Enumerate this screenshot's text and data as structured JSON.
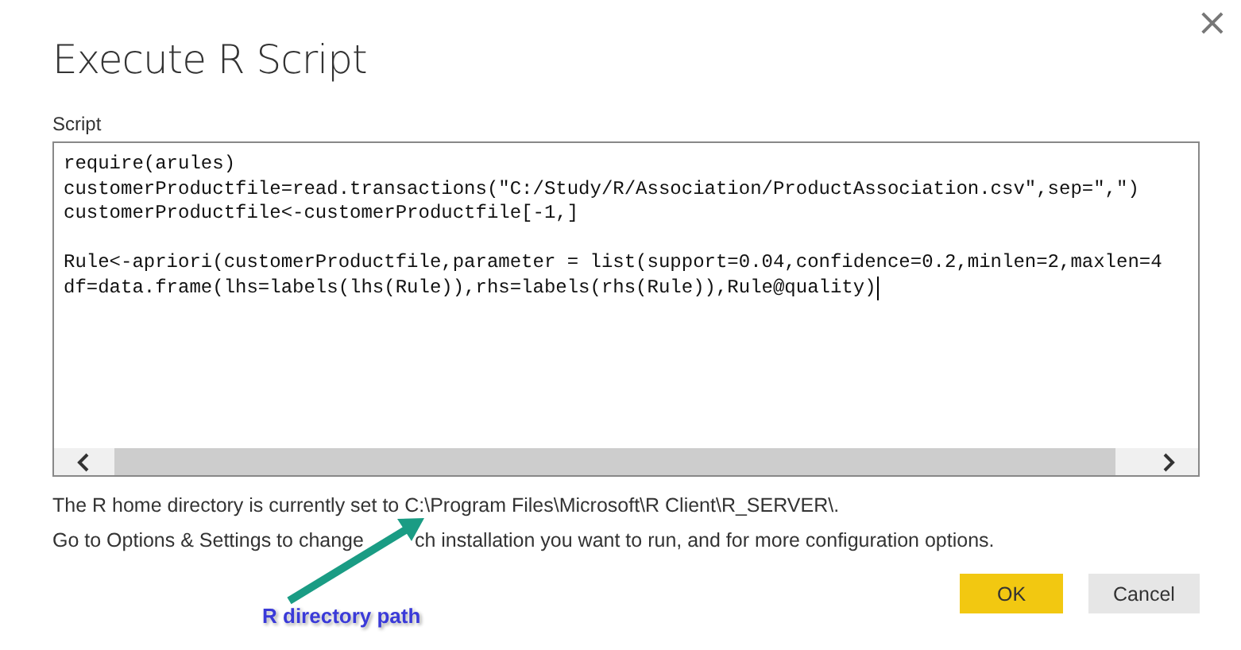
{
  "dialog": {
    "title": "Execute R Script",
    "close_glyph": "×"
  },
  "script": {
    "label": "Script",
    "caret_at_end": true,
    "blocks": [
      {
        "lines": [
          "require(arules)",
          "customerProductfile=read.transactions(\"C:/Study/R/Association/ProductAssociation.csv\",sep=\",\")",
          "customerProductfile<-customerProductfile[-1,]"
        ]
      },
      {
        "lines": [
          "Rule<-apriori(customerProductfile,parameter = list(support=0.04,confidence=0.2,minlen=2,maxlen=4",
          "df=data.frame(lhs=labels(lhs(Rule)),rhs=labels(rhs(Rule)),Rule@quality)"
        ]
      }
    ]
  },
  "info": {
    "home_directory": "The R home directory is currently set to C:\\Program Files\\Microsoft\\R Client\\R_SERVER\\.",
    "options_before": "Go to Options & Settings to change",
    "options_after": "ch installation you want to run, and for more configuration options."
  },
  "annotation": {
    "label": "R directory path"
  },
  "buttons": [
    {
      "label": "OK",
      "kind": "primary"
    },
    {
      "label": "Cancel",
      "kind": "secondary"
    }
  ]
}
